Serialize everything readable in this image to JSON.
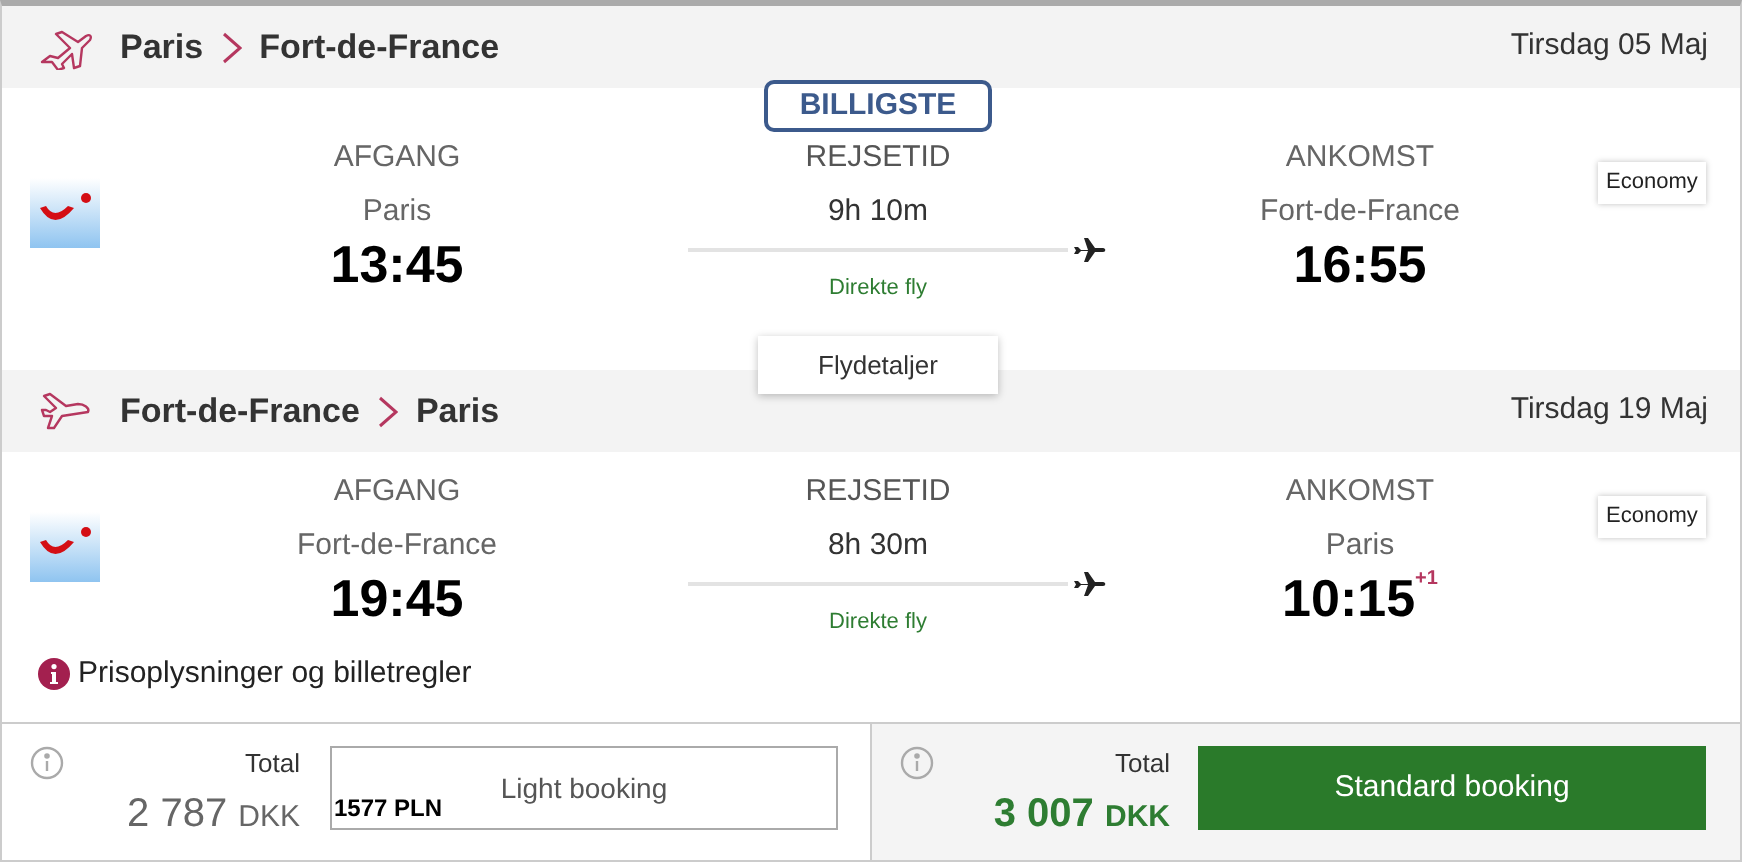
{
  "legs": [
    {
      "from": "Paris",
      "to": "Fort-de-France",
      "date": "Tirsdag 05 Maj",
      "badge": "BILLIGSTE",
      "departure": {
        "label": "AFGANG",
        "city": "Paris",
        "time": "13:45"
      },
      "duration": {
        "label": "REJSETID",
        "value": "9h 10m",
        "stops": "Direkte fly"
      },
      "arrival": {
        "label": "ANKOMST",
        "city": "Fort-de-France",
        "time": "16:55"
      },
      "cabin": "Economy",
      "details_button": "Flydetaljer"
    },
    {
      "from": "Fort-de-France",
      "to": "Paris",
      "date": "Tirsdag 19 Maj",
      "departure": {
        "label": "AFGANG",
        "city": "Fort-de-France",
        "time": "19:45"
      },
      "duration": {
        "label": "REJSETID",
        "value": "8h 30m",
        "stops": "Direkte fly"
      },
      "arrival": {
        "label": "ANKOMST",
        "city": "Paris",
        "time": "10:15",
        "day_offset": "+1"
      },
      "cabin": "Economy"
    }
  ],
  "info_link": "Prisoplysninger og billetregler",
  "options": [
    {
      "kind": "light",
      "total_label": "Total",
      "amount": "2 787",
      "currency": "DKK",
      "button": "Light booking",
      "note": "1577 PLN"
    },
    {
      "kind": "standard",
      "total_label": "Total",
      "amount": "3 007",
      "currency": "DKK",
      "button": "Standard booking"
    }
  ]
}
